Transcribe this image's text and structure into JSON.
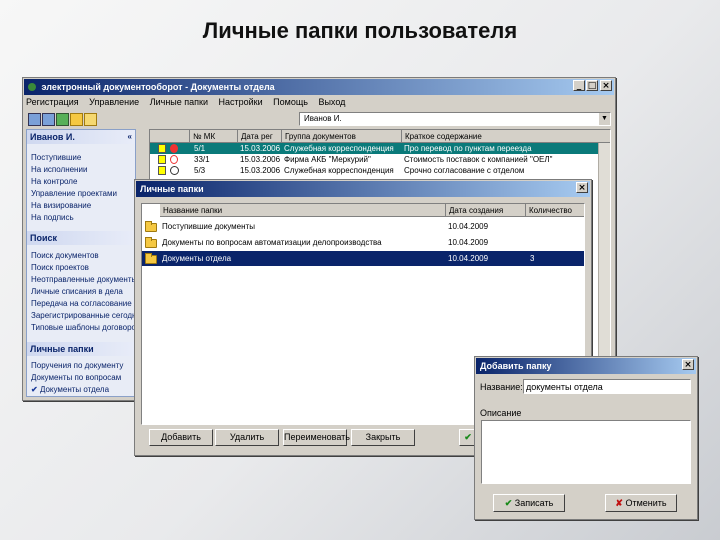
{
  "slide_title": "Личные папки пользователя",
  "main_window": {
    "title": "электронный документооборот - Документы отдела",
    "menu": [
      "Регистрация",
      "Управление",
      "Личные папки",
      "Настройки",
      "Помощь",
      "Выход"
    ],
    "user_combo": "Иванов И.",
    "sidebar": {
      "user_header": "Иванов И.",
      "user_links": [
        "Поступившие",
        "На исполнении",
        "На контроле",
        "Управление проектами",
        "На визирование",
        "На подпись"
      ],
      "search_header": "Поиск",
      "search_links": [
        "Поиск документов",
        "Поиск проектов",
        "Неотправленные документы",
        "Личные списания в дела",
        "Передача на согласование",
        "Зарегистрированные сегодня",
        "Типовые шаблоны договоров"
      ],
      "folders_header": "Личные папки",
      "folder_links": [
        "Поручения по документу",
        "Документы по вопросам",
        "Документы отдела"
      ]
    },
    "table": {
      "headers": [
        "",
        "№ МК",
        "Дата рег",
        "Группа документов",
        "Краткое содержание"
      ],
      "rows": [
        {
          "num": "5/1",
          "date": "15.03.2006",
          "group": "Служебная корреспонденция",
          "summary": "Про перевод по пунктам переезда"
        },
        {
          "num": "33/1",
          "date": "15.03.2006",
          "group": "Фирма АКБ \"Меркурий\"",
          "summary": "Стоимость поставок с компанией \"ОЕЛ\""
        },
        {
          "num": "5/3",
          "date": "15.03.2006",
          "group": "Служебная корреспонденция",
          "summary": "Срочно согласование с отделом"
        }
      ]
    }
  },
  "folders_dialog": {
    "title": "Личные папки",
    "headers": [
      "Название папки",
      "Дата создания",
      "Количество"
    ],
    "rows": [
      {
        "name": "Поступившие документы",
        "date": "10.04.2009",
        "count": ""
      },
      {
        "name": "Документы по вопросам автоматизации делопроизводства",
        "date": "10.04.2009",
        "count": ""
      },
      {
        "name": "Документы отдела",
        "date": "10.04.2009",
        "count": "3"
      }
    ],
    "buttons": {
      "add": "Добавить",
      "delete": "Удалить",
      "rename": "Переименовать",
      "close": "Закрыть"
    }
  },
  "add_dialog": {
    "title": "Добавить папку",
    "name_label": "Название:",
    "name_value": "документы отдела",
    "desc_label": "Описание",
    "save": "Записать",
    "cancel": "Отменить"
  }
}
